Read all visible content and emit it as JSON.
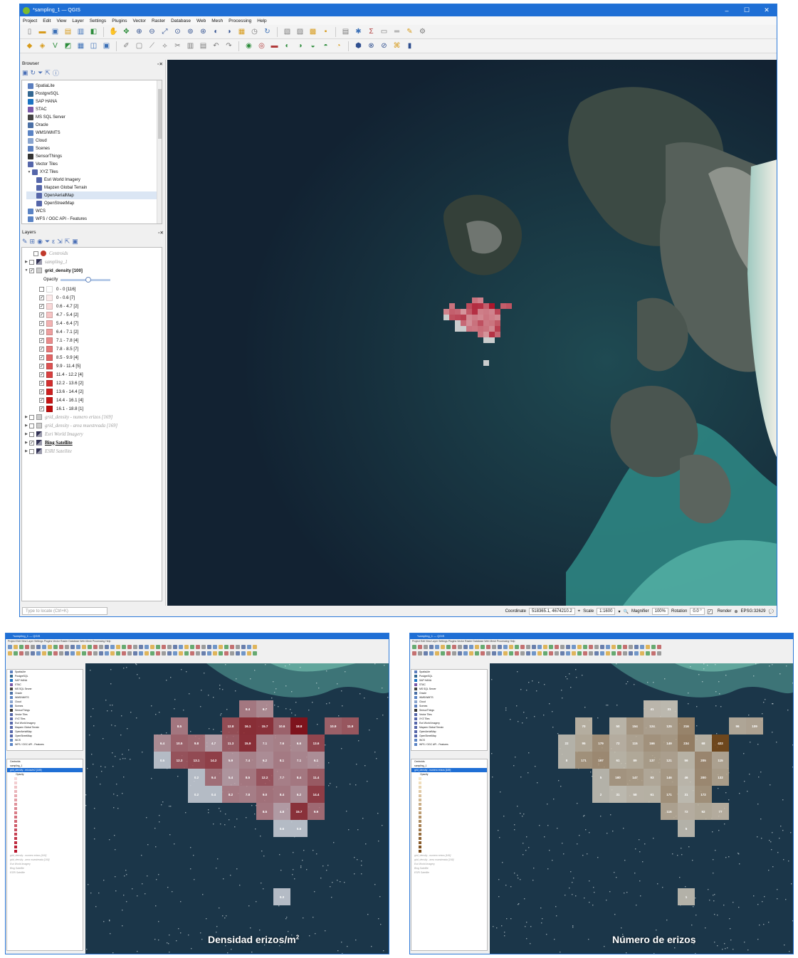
{
  "window": {
    "title": "*sampling_1 — QGIS",
    "menu": [
      "Project",
      "Edit",
      "View",
      "Layer",
      "Settings",
      "Plugins",
      "Vector",
      "Raster",
      "Database",
      "Web",
      "Mesh",
      "Processing",
      "Help"
    ]
  },
  "browser": {
    "title": "Browser",
    "items": [
      {
        "label": "SpatiaLite",
        "icon": "feather-icon",
        "color": "#5b7fbf"
      },
      {
        "label": "PostgreSQL",
        "icon": "elephant-icon",
        "color": "#336791"
      },
      {
        "label": "SAP HANA",
        "icon": "database-icon",
        "color": "#1a73c2"
      },
      {
        "label": "STAC",
        "icon": "stac-icon",
        "color": "#7a59a8"
      },
      {
        "label": "MS SQL Server",
        "icon": "mssql-icon",
        "color": "#444444"
      },
      {
        "label": "Oracle",
        "icon": "oracle-icon",
        "color": "#4a6fa5"
      },
      {
        "label": "WMS/WMTS",
        "icon": "globe-icon",
        "color": "#5a83c4"
      },
      {
        "label": "Cloud",
        "icon": "cloud-icon",
        "color": "#8aa5cf"
      },
      {
        "label": "Scenes",
        "icon": "scenes-icon",
        "color": "#5b7fbf"
      },
      {
        "label": "SensorThings",
        "icon": "sensor-icon",
        "color": "#333333"
      },
      {
        "label": "Vector Tiles",
        "icon": "grid-icon",
        "color": "#5566aa"
      },
      {
        "label": "XYZ Tiles",
        "icon": "grid-icon",
        "color": "#5566aa"
      },
      {
        "label": "Esri World Imagery",
        "icon": "grid-icon",
        "color": "#5566aa"
      },
      {
        "label": "Mapzen Global Terrain",
        "icon": "grid-icon",
        "color": "#5566aa"
      },
      {
        "label": "OpenAerialMap",
        "icon": "grid-icon",
        "color": "#5566aa"
      },
      {
        "label": "OpenStreetMap",
        "icon": "grid-icon",
        "color": "#5566aa"
      },
      {
        "label": "WCS",
        "icon": "globe-icon",
        "color": "#5a83c4"
      },
      {
        "label": "WFS / OGC API - Features",
        "icon": "globe-icon",
        "color": "#5a83c4"
      }
    ]
  },
  "layers": {
    "title": "Layers",
    "opacity_label": "Opacity",
    "opacity": 0.55,
    "items": [
      {
        "name": "Centroids",
        "checked": false,
        "style": "italic",
        "symbol": "dot"
      },
      {
        "name": "sampling_1",
        "checked": false,
        "style": "italic",
        "symbol": "raster"
      },
      {
        "name": "grid_density [100]",
        "checked": true,
        "style": "bold",
        "symbol": "poly"
      }
    ],
    "legend": [
      {
        "label": "0 - 0 [116]",
        "checked": false,
        "color": "#ffffff"
      },
      {
        "label": "0 - 0.6 [7]",
        "checked": true,
        "color": "#fcebeb"
      },
      {
        "label": "0.6 - 4.7 [2]",
        "checked": true,
        "color": "#f8d8d8"
      },
      {
        "label": "4.7 - 5.4 [2]",
        "checked": true,
        "color": "#f5c4c4"
      },
      {
        "label": "5.4 - 6.4 [7]",
        "checked": true,
        "color": "#f2b2b2"
      },
      {
        "label": "6.4 - 7.1 [2]",
        "checked": true,
        "color": "#ee9f9f"
      },
      {
        "label": "7.1 - 7.8 [4]",
        "checked": true,
        "color": "#ea8b8b"
      },
      {
        "label": "7.8 - 8.5 [7]",
        "checked": true,
        "color": "#e67878"
      },
      {
        "label": "8.5 - 9.9 [4]",
        "checked": true,
        "color": "#e26565"
      },
      {
        "label": "9.9 - 11.4 [5]",
        "checked": true,
        "color": "#dd5252"
      },
      {
        "label": "11.4 - 12.2 [4]",
        "checked": true,
        "color": "#d94040"
      },
      {
        "label": "12.2 - 13.6 [2]",
        "checked": true,
        "color": "#d42f2f"
      },
      {
        "label": "13.6 - 14.4 [2]",
        "checked": true,
        "color": "#cf2020"
      },
      {
        "label": "14.4 - 16.1 [4]",
        "checked": true,
        "color": "#c81515"
      },
      {
        "label": "16.1 - 18.8 [1]",
        "checked": true,
        "color": "#bf0c0c"
      }
    ],
    "more": [
      {
        "name": "grid_density - numero erizos [169]",
        "checked": false
      },
      {
        "name": "grid_density - area muestreada [169]",
        "checked": false
      },
      {
        "name": "Esri World Imagery",
        "checked": false
      },
      {
        "name": "Bing Satellite",
        "checked": true
      },
      {
        "name": "ESRI Satellite",
        "checked": false
      }
    ]
  },
  "locator_placeholder": "Type to locate (Ctrl+K)",
  "status": {
    "coordinate_label": "Coordinate",
    "coordinate": "518365.1, 4674210.2",
    "scale_label": "Scale",
    "scale": "1:1600",
    "magnifier_label": "Magnifier",
    "magnifier": "100%",
    "rotation_label": "Rotation",
    "rotation": "0.0 °",
    "render_label": "Render",
    "crs": "EPSG:32629"
  },
  "density_cells": [
    {
      "c": 5,
      "r": 0,
      "v": "8.4"
    },
    {
      "c": 6,
      "r": 0,
      "v": "6.7"
    },
    {
      "c": 1,
      "r": 1,
      "v": "8.5"
    },
    {
      "c": 4,
      "r": 1,
      "v": "12.8"
    },
    {
      "c": 5,
      "r": 1,
      "v": "16.1"
    },
    {
      "c": 6,
      "r": 1,
      "v": "15.7"
    },
    {
      "c": 7,
      "r": 1,
      "v": "10.6"
    },
    {
      "c": 8,
      "r": 1,
      "v": "18.8"
    },
    {
      "c": 10,
      "r": 1,
      "v": "10.9"
    },
    {
      "c": 11,
      "r": 1,
      "v": "11.9"
    },
    {
      "c": 0,
      "r": 2,
      "v": "6.4"
    },
    {
      "c": 1,
      "r": 2,
      "v": "10.5"
    },
    {
      "c": 2,
      "r": 2,
      "v": "9.8"
    },
    {
      "c": 3,
      "r": 2,
      "v": "4.7"
    },
    {
      "c": 4,
      "r": 2,
      "v": "11.3"
    },
    {
      "c": 5,
      "r": 2,
      "v": "15.9"
    },
    {
      "c": 6,
      "r": 2,
      "v": "7.1"
    },
    {
      "c": 7,
      "r": 2,
      "v": "7.6"
    },
    {
      "c": 8,
      "r": 2,
      "v": "6.6"
    },
    {
      "c": 9,
      "r": 2,
      "v": "13.6"
    },
    {
      "c": 0,
      "r": 3,
      "v": "0.5"
    },
    {
      "c": 1,
      "r": 3,
      "v": "12.3"
    },
    {
      "c": 2,
      "r": 3,
      "v": "13.1"
    },
    {
      "c": 3,
      "r": 3,
      "v": "14.2"
    },
    {
      "c": 4,
      "r": 3,
      "v": "5.9"
    },
    {
      "c": 5,
      "r": 3,
      "v": "7.4"
    },
    {
      "c": 6,
      "r": 3,
      "v": "6.2"
    },
    {
      "c": 7,
      "r": 3,
      "v": "8.1"
    },
    {
      "c": 8,
      "r": 3,
      "v": "7.1"
    },
    {
      "c": 9,
      "r": 3,
      "v": "6.1"
    },
    {
      "c": 2,
      "r": 4,
      "v": "0.2"
    },
    {
      "c": 3,
      "r": 4,
      "v": "9.4"
    },
    {
      "c": 4,
      "r": 4,
      "v": "5.4"
    },
    {
      "c": 5,
      "r": 4,
      "v": "8.5"
    },
    {
      "c": 6,
      "r": 4,
      "v": "12.2"
    },
    {
      "c": 7,
      "r": 4,
      "v": "7.7"
    },
    {
      "c": 8,
      "r": 4,
      "v": "8.4"
    },
    {
      "c": 9,
      "r": 4,
      "v": "11.4"
    },
    {
      "c": 2,
      "r": 5,
      "v": "0.2"
    },
    {
      "c": 3,
      "r": 5,
      "v": "0.4"
    },
    {
      "c": 4,
      "r": 5,
      "v": "8.2"
    },
    {
      "c": 5,
      "r": 5,
      "v": "7.8"
    },
    {
      "c": 6,
      "r": 5,
      "v": "9.0"
    },
    {
      "c": 7,
      "r": 5,
      "v": "8.4"
    },
    {
      "c": 8,
      "r": 5,
      "v": "6.2"
    },
    {
      "c": 9,
      "r": 5,
      "v": "14.4"
    },
    {
      "c": 6,
      "r": 6,
      "v": "8.5"
    },
    {
      "c": 7,
      "r": 6,
      "v": "4.8"
    },
    {
      "c": 8,
      "r": 6,
      "v": "15.7"
    },
    {
      "c": 9,
      "r": 6,
      "v": "9.9"
    },
    {
      "c": 7,
      "r": 7,
      "v": "0.6"
    },
    {
      "c": 8,
      "r": 7,
      "v": "0.5"
    },
    {
      "c": 7,
      "r": 11,
      "v": "0.3"
    }
  ],
  "number_cells": [
    {
      "c": 5,
      "r": 0,
      "v": "41"
    },
    {
      "c": 6,
      "r": 0,
      "v": "31"
    },
    {
      "c": 1,
      "r": 1,
      "v": "70"
    },
    {
      "c": 3,
      "r": 1,
      "v": "50"
    },
    {
      "c": 4,
      "r": 1,
      "v": "154"
    },
    {
      "c": 5,
      "r": 1,
      "v": "124"
    },
    {
      "c": 6,
      "r": 1,
      "v": "125"
    },
    {
      "c": 7,
      "r": 1,
      "v": "216"
    },
    {
      "c": 10,
      "r": 1,
      "v": "96"
    },
    {
      "c": 11,
      "r": 1,
      "v": "109"
    },
    {
      "c": 0,
      "r": 2,
      "v": "22"
    },
    {
      "c": 1,
      "r": 2,
      "v": "95"
    },
    {
      "c": 2,
      "r": 2,
      "v": "179"
    },
    {
      "c": 3,
      "r": 2,
      "v": "72"
    },
    {
      "c": 4,
      "r": 2,
      "v": "115"
    },
    {
      "c": 5,
      "r": 2,
      "v": "166"
    },
    {
      "c": 6,
      "r": 2,
      "v": "149"
    },
    {
      "c": 7,
      "r": 2,
      "v": "234"
    },
    {
      "c": 8,
      "r": 2,
      "v": "68"
    },
    {
      "c": 9,
      "r": 2,
      "v": "422"
    },
    {
      "c": 0,
      "r": 3,
      "v": "8"
    },
    {
      "c": 1,
      "r": 3,
      "v": "171"
    },
    {
      "c": 2,
      "r": 3,
      "v": "197"
    },
    {
      "c": 3,
      "r": 3,
      "v": "61"
    },
    {
      "c": 4,
      "r": 3,
      "v": "89"
    },
    {
      "c": 5,
      "r": 3,
      "v": "137"
    },
    {
      "c": 6,
      "r": 3,
      "v": "121"
    },
    {
      "c": 7,
      "r": 3,
      "v": "56"
    },
    {
      "c": 8,
      "r": 3,
      "v": "205"
    },
    {
      "c": 9,
      "r": 3,
      "v": "115"
    },
    {
      "c": 2,
      "r": 4,
      "v": "5"
    },
    {
      "c": 3,
      "r": 4,
      "v": "160"
    },
    {
      "c": 4,
      "r": 4,
      "v": "147"
    },
    {
      "c": 5,
      "r": 4,
      "v": "93"
    },
    {
      "c": 6,
      "r": 4,
      "v": "146"
    },
    {
      "c": 7,
      "r": 4,
      "v": "46"
    },
    {
      "c": 8,
      "r": 4,
      "v": "200"
    },
    {
      "c": 9,
      "r": 4,
      "v": "132"
    },
    {
      "c": 2,
      "r": 5,
      "v": "2"
    },
    {
      "c": 3,
      "r": 5,
      "v": "31"
    },
    {
      "c": 4,
      "r": 5,
      "v": "58"
    },
    {
      "c": 5,
      "r": 5,
      "v": "61"
    },
    {
      "c": 6,
      "r": 5,
      "v": "171"
    },
    {
      "c": 7,
      "r": 5,
      "v": "31"
    },
    {
      "c": 8,
      "r": 5,
      "v": "172"
    },
    {
      "c": 6,
      "r": 6,
      "v": "116"
    },
    {
      "c": 7,
      "r": 6,
      "v": "72"
    },
    {
      "c": 8,
      "r": 6,
      "v": "92"
    },
    {
      "c": 9,
      "r": 6,
      "v": "77"
    },
    {
      "c": 7,
      "r": 7,
      "v": "5"
    },
    {
      "c": 7,
      "r": 11,
      "v": "1"
    }
  ],
  "captions": {
    "density_base": "Densidad erizos/m",
    "density_sup": "2",
    "number": "Número de erizos"
  },
  "thumb_titles": {
    "density": "*sampling_1 — QGIS",
    "number": "*sampling_1 — QGIS"
  },
  "thumb_layers": {
    "density_selected": "grid_density - erizos/m2 [169]",
    "number_selected": "grid_density - numero erizos [169]"
  },
  "colors": {
    "accent": "#1f6fd5",
    "density_high": "#8c0f16",
    "density_low": "#d8dde3",
    "number_high": "#7a4a17",
    "number_low": "#d9d5c9"
  }
}
